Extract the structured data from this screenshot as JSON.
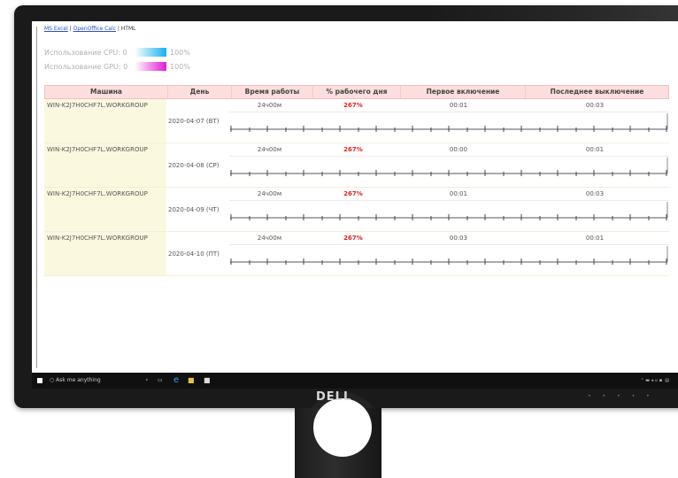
{
  "links": {
    "excel": "MS Excel",
    "oo": "OpenOffice Calc",
    "html": "HTML"
  },
  "usage": {
    "cpu": {
      "label": "Использование CPU: 0",
      "max": "100%",
      "color": "#17b1f0"
    },
    "gpu": {
      "label": "Использование GPU: 0",
      "max": "100%",
      "color": "#e21ad5"
    }
  },
  "table": {
    "headers": [
      "Машина",
      "День",
      "Время работы",
      "% рабочего дня",
      "Первое включение",
      "Последнее выключение"
    ],
    "rows": [
      {
        "machine": "WIN-K2J7H0CHF7L.WORKGROUP",
        "day": "2020-04-07 (ВТ)",
        "uptime": "24ч00м",
        "pct": "267%",
        "first": "00:01",
        "last": "00:03"
      },
      {
        "machine": "WIN-K2J7H0CHF7L.WORKGROUP",
        "day": "2020-04-08 (СР)",
        "uptime": "24ч00м",
        "pct": "267%",
        "first": "00:00",
        "last": "00:01"
      },
      {
        "machine": "WIN-K2J7H0CHF7L.WORKGROUP",
        "day": "2020-04-09 (ЧТ)",
        "uptime": "24ч00м",
        "pct": "267%",
        "first": "00:01",
        "last": "00:03"
      },
      {
        "machine": "WIN-K2J7H0CHF7L.WORKGROUP",
        "day": "2020-04-10 (ПТ)",
        "uptime": "24ч00м",
        "pct": "267%",
        "first": "00:03",
        "last": "00:01"
      }
    ]
  },
  "taskbar": {
    "search": "Ask me anything"
  },
  "brand": "DELL"
}
